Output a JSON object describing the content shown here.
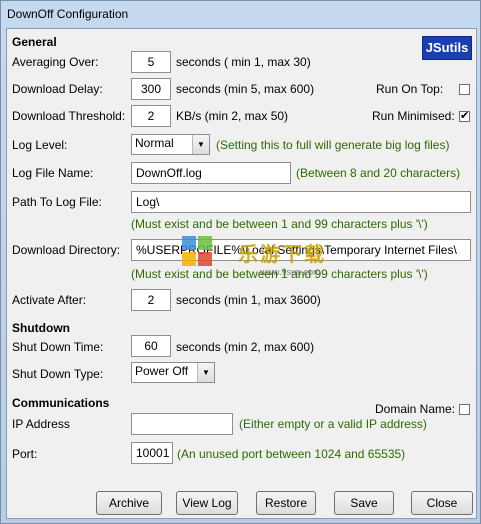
{
  "window": {
    "title": "DownOff Configuration"
  },
  "logo": "JSutils",
  "watermark": {
    "text": "乐游下载",
    "sub": "www.9sun.com"
  },
  "sections": {
    "general": "General",
    "shutdown": "Shutdown",
    "communications": "Communications"
  },
  "general": {
    "averaging_over": {
      "label": "Averaging Over:",
      "value": "5",
      "hint": "seconds ( min 1, max 30)"
    },
    "download_delay": {
      "label": "Download Delay:",
      "value": "300",
      "hint": "seconds (min 5, max 600)"
    },
    "download_threshold": {
      "label": "Download Threshold:",
      "value": "2",
      "hint": "KB/s (min 2, max 50)"
    },
    "run_on_top": {
      "label": "Run On Top:",
      "checked": false
    },
    "run_minimised": {
      "label": "Run Minimised:",
      "checked": true,
      "mark": "✔"
    },
    "log_level": {
      "label": "Log Level:",
      "value": "Normal",
      "hint": "(Setting this to full will generate big log files)"
    },
    "log_file_name": {
      "label": "Log File Name:",
      "value": "DownOff.log",
      "hint": "(Between 8 and 20 characters)"
    },
    "path_to_log_file": {
      "label": "Path To Log File:",
      "value": "Log\\",
      "hint": "(Must exist and be between 1 and 99 characters plus '\\')"
    },
    "download_directory": {
      "label": "Download Directory:",
      "value": "%USERPROFILE%\\Local Settings\\Temporary Internet Files\\",
      "hint": "(Must exist and be between 1 and 99 characters plus '\\')"
    },
    "activate_after": {
      "label": "Activate After:",
      "value": "2",
      "hint": "seconds (min 1, max 3600)"
    }
  },
  "shutdown": {
    "shut_down_time": {
      "label": "Shut Down Time:",
      "value": "60",
      "hint": "seconds (min 2, max 600)"
    },
    "shut_down_type": {
      "label": "Shut Down Type:",
      "value": "Power Off"
    }
  },
  "communications": {
    "domain_name": {
      "label": "Domain Name:",
      "checked": false
    },
    "ip_address": {
      "label": "IP Address",
      "value": "",
      "hint": "(Either empty or a valid IP address)"
    },
    "port": {
      "label": "Port:",
      "value": "10001",
      "hint": "(An unused port between 1024 and 65535)"
    }
  },
  "buttons": {
    "archive": "Archive",
    "view_log": "View Log",
    "restore": "Restore",
    "save": "Save",
    "close": "Close"
  }
}
